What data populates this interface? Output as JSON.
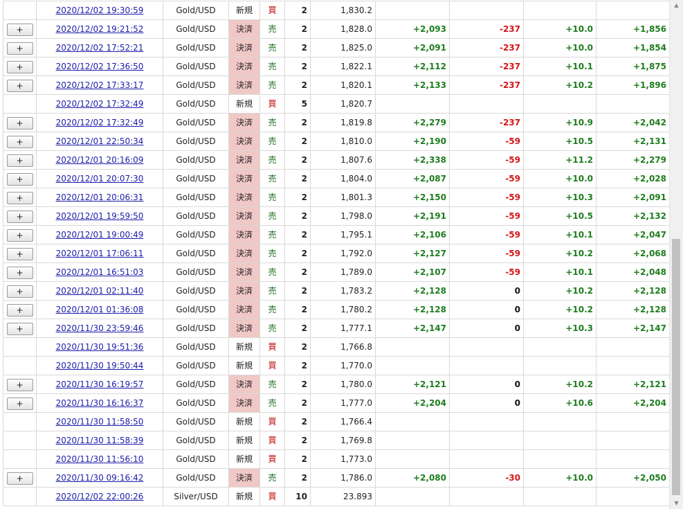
{
  "button_label": "+",
  "rows": [
    {
      "btn": false,
      "time": "2020/12/02 19:30:59",
      "symbol": "Gold/USD",
      "type": "新規",
      "side": "買",
      "qty": "2",
      "price": "1,830.2",
      "pl1": "",
      "pl2": "",
      "pl3": "",
      "pl4": ""
    },
    {
      "btn": true,
      "time": "2020/12/02 19:21:52",
      "symbol": "Gold/USD",
      "type": "決済",
      "side": "売",
      "qty": "2",
      "price": "1,828.0",
      "pl1": "+2,093",
      "pl2": "-237",
      "pl3": "+10.0",
      "pl4": "+1,856"
    },
    {
      "btn": true,
      "time": "2020/12/02 17:52:21",
      "symbol": "Gold/USD",
      "type": "決済",
      "side": "売",
      "qty": "2",
      "price": "1,825.0",
      "pl1": "+2,091",
      "pl2": "-237",
      "pl3": "+10.0",
      "pl4": "+1,854"
    },
    {
      "btn": true,
      "time": "2020/12/02 17:36:50",
      "symbol": "Gold/USD",
      "type": "決済",
      "side": "売",
      "qty": "2",
      "price": "1,822.1",
      "pl1": "+2,112",
      "pl2": "-237",
      "pl3": "+10.1",
      "pl4": "+1,875"
    },
    {
      "btn": true,
      "time": "2020/12/02 17:33:17",
      "symbol": "Gold/USD",
      "type": "決済",
      "side": "売",
      "qty": "2",
      "price": "1,820.1",
      "pl1": "+2,133",
      "pl2": "-237",
      "pl3": "+10.2",
      "pl4": "+1,896"
    },
    {
      "btn": false,
      "time": "2020/12/02 17:32:49",
      "symbol": "Gold/USD",
      "type": "新規",
      "side": "買",
      "qty": "5",
      "price": "1,820.7",
      "pl1": "",
      "pl2": "",
      "pl3": "",
      "pl4": ""
    },
    {
      "btn": true,
      "time": "2020/12/02 17:32:49",
      "symbol": "Gold/USD",
      "type": "決済",
      "side": "売",
      "qty": "2",
      "price": "1,819.8",
      "pl1": "+2,279",
      "pl2": "-237",
      "pl3": "+10.9",
      "pl4": "+2,042"
    },
    {
      "btn": true,
      "time": "2020/12/01 22:50:34",
      "symbol": "Gold/USD",
      "type": "決済",
      "side": "売",
      "qty": "2",
      "price": "1,810.0",
      "pl1": "+2,190",
      "pl2": "-59",
      "pl3": "+10.5",
      "pl4": "+2,131"
    },
    {
      "btn": true,
      "time": "2020/12/01 20:16:09",
      "symbol": "Gold/USD",
      "type": "決済",
      "side": "売",
      "qty": "2",
      "price": "1,807.6",
      "pl1": "+2,338",
      "pl2": "-59",
      "pl3": "+11.2",
      "pl4": "+2,279"
    },
    {
      "btn": true,
      "time": "2020/12/01 20:07:30",
      "symbol": "Gold/USD",
      "type": "決済",
      "side": "売",
      "qty": "2",
      "price": "1,804.0",
      "pl1": "+2,087",
      "pl2": "-59",
      "pl3": "+10.0",
      "pl4": "+2,028"
    },
    {
      "btn": true,
      "time": "2020/12/01 20:06:31",
      "symbol": "Gold/USD",
      "type": "決済",
      "side": "売",
      "qty": "2",
      "price": "1,801.3",
      "pl1": "+2,150",
      "pl2": "-59",
      "pl3": "+10.3",
      "pl4": "+2,091"
    },
    {
      "btn": true,
      "time": "2020/12/01 19:59:50",
      "symbol": "Gold/USD",
      "type": "決済",
      "side": "売",
      "qty": "2",
      "price": "1,798.0",
      "pl1": "+2,191",
      "pl2": "-59",
      "pl3": "+10.5",
      "pl4": "+2,132"
    },
    {
      "btn": true,
      "time": "2020/12/01 19:00:49",
      "symbol": "Gold/USD",
      "type": "決済",
      "side": "売",
      "qty": "2",
      "price": "1,795.1",
      "pl1": "+2,106",
      "pl2": "-59",
      "pl3": "+10.1",
      "pl4": "+2,047"
    },
    {
      "btn": true,
      "time": "2020/12/01 17:06:11",
      "symbol": "Gold/USD",
      "type": "決済",
      "side": "売",
      "qty": "2",
      "price": "1,792.0",
      "pl1": "+2,127",
      "pl2": "-59",
      "pl3": "+10.2",
      "pl4": "+2,068"
    },
    {
      "btn": true,
      "time": "2020/12/01 16:51:03",
      "symbol": "Gold/USD",
      "type": "決済",
      "side": "売",
      "qty": "2",
      "price": "1,789.0",
      "pl1": "+2,107",
      "pl2": "-59",
      "pl3": "+10.1",
      "pl4": "+2,048"
    },
    {
      "btn": true,
      "time": "2020/12/01 02:11:40",
      "symbol": "Gold/USD",
      "type": "決済",
      "side": "売",
      "qty": "2",
      "price": "1,783.2",
      "pl1": "+2,128",
      "pl2": "0",
      "pl3": "+10.2",
      "pl4": "+2,128"
    },
    {
      "btn": true,
      "time": "2020/12/01 01:36:08",
      "symbol": "Gold/USD",
      "type": "決済",
      "side": "売",
      "qty": "2",
      "price": "1,780.2",
      "pl1": "+2,128",
      "pl2": "0",
      "pl3": "+10.2",
      "pl4": "+2,128"
    },
    {
      "btn": true,
      "time": "2020/11/30 23:59:46",
      "symbol": "Gold/USD",
      "type": "決済",
      "side": "売",
      "qty": "2",
      "price": "1,777.1",
      "pl1": "+2,147",
      "pl2": "0",
      "pl3": "+10.3",
      "pl4": "+2,147"
    },
    {
      "btn": false,
      "time": "2020/11/30 19:51:36",
      "symbol": "Gold/USD",
      "type": "新規",
      "side": "買",
      "qty": "2",
      "price": "1,766.8",
      "pl1": "",
      "pl2": "",
      "pl3": "",
      "pl4": ""
    },
    {
      "btn": false,
      "time": "2020/11/30 19:50:44",
      "symbol": "Gold/USD",
      "type": "新規",
      "side": "買",
      "qty": "2",
      "price": "1,770.0",
      "pl1": "",
      "pl2": "",
      "pl3": "",
      "pl4": ""
    },
    {
      "btn": true,
      "time": "2020/11/30 16:19:57",
      "symbol": "Gold/USD",
      "type": "決済",
      "side": "売",
      "qty": "2",
      "price": "1,780.0",
      "pl1": "+2,121",
      "pl2": "0",
      "pl3": "+10.2",
      "pl4": "+2,121"
    },
    {
      "btn": true,
      "time": "2020/11/30 16:16:37",
      "symbol": "Gold/USD",
      "type": "決済",
      "side": "売",
      "qty": "2",
      "price": "1,777.0",
      "pl1": "+2,204",
      "pl2": "0",
      "pl3": "+10.6",
      "pl4": "+2,204"
    },
    {
      "btn": false,
      "time": "2020/11/30 11:58:50",
      "symbol": "Gold/USD",
      "type": "新規",
      "side": "買",
      "qty": "2",
      "price": "1,766.4",
      "pl1": "",
      "pl2": "",
      "pl3": "",
      "pl4": ""
    },
    {
      "btn": false,
      "time": "2020/11/30 11:58:39",
      "symbol": "Gold/USD",
      "type": "新規",
      "side": "買",
      "qty": "2",
      "price": "1,769.8",
      "pl1": "",
      "pl2": "",
      "pl3": "",
      "pl4": ""
    },
    {
      "btn": false,
      "time": "2020/11/30 11:56:10",
      "symbol": "Gold/USD",
      "type": "新規",
      "side": "買",
      "qty": "2",
      "price": "1,773.0",
      "pl1": "",
      "pl2": "",
      "pl3": "",
      "pl4": ""
    },
    {
      "btn": true,
      "time": "2020/11/30 09:16:42",
      "symbol": "Gold/USD",
      "type": "決済",
      "side": "売",
      "qty": "2",
      "price": "1,786.0",
      "pl1": "+2,080",
      "pl2": "-30",
      "pl3": "+10.0",
      "pl4": "+2,050"
    },
    {
      "btn": false,
      "time": "2020/12/02 22:00:26",
      "symbol": "Silver/USD",
      "type": "新規",
      "side": "買",
      "qty": "10",
      "price": "23.893",
      "pl1": "",
      "pl2": "",
      "pl3": "",
      "pl4": ""
    }
  ],
  "colors": {
    "positive": "#1e7d1e",
    "negative": "#d41414",
    "settle_bg": "#f0c8c6",
    "buy": "#c00000",
    "sell": "#1a6a1a",
    "link": "#1b1baa"
  },
  "scrollbar": {
    "up_icon": "▲",
    "down_icon": "▼"
  }
}
